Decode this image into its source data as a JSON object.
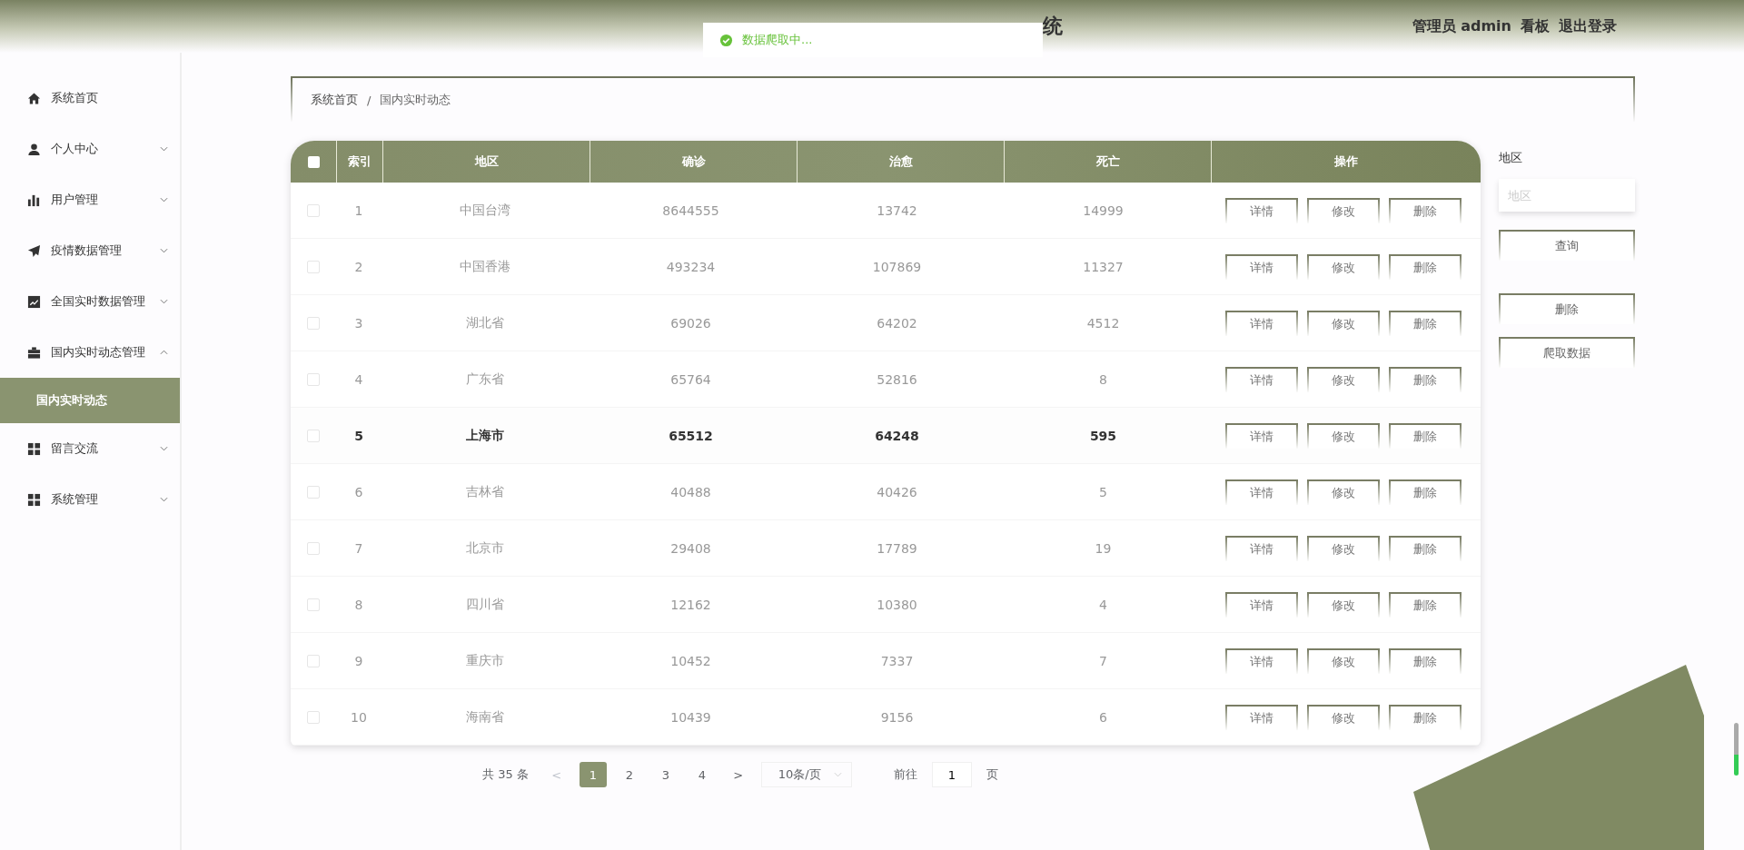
{
  "header": {
    "title_visible": "统",
    "user": "管理员 admin",
    "links": [
      "看板",
      "退出登录"
    ]
  },
  "toast": {
    "kind": "success",
    "message": "数据爬取中..."
  },
  "sidebar": {
    "items": [
      {
        "label": "系统首页",
        "expandable": false
      },
      {
        "label": "个人中心",
        "expandable": true,
        "expanded": false
      },
      {
        "label": "用户管理",
        "expandable": true,
        "expanded": false
      },
      {
        "label": "疫情数据管理",
        "expandable": true,
        "expanded": false
      },
      {
        "label": "全国实时数据管理",
        "expandable": true,
        "expanded": false
      },
      {
        "label": "国内实时动态管理",
        "expandable": true,
        "expanded": true,
        "children": [
          {
            "label": "国内实时动态",
            "selected": true
          }
        ]
      },
      {
        "label": "留言交流",
        "expandable": true,
        "expanded": false
      },
      {
        "label": "系统管理",
        "expandable": true,
        "expanded": false
      }
    ]
  },
  "breadcrumb": {
    "items": [
      "系统首页",
      "国内实时动态"
    ],
    "separator": "/"
  },
  "table": {
    "columns": [
      "索引",
      "地区",
      "确诊",
      "治愈",
      "死亡",
      "操作"
    ],
    "select_all_checked": false,
    "rows": [
      {
        "index": "1",
        "region": "中国台湾",
        "confirmed": "8644555",
        "cured": "13742",
        "deaths": "14999",
        "highlighted": false,
        "checked": false,
        "actions": [
          "详情",
          "修改",
          "删除"
        ]
      },
      {
        "index": "2",
        "region": "中国香港",
        "confirmed": "493234",
        "cured": "107869",
        "deaths": "11327",
        "highlighted": false,
        "checked": false,
        "actions": [
          "详情",
          "修改",
          "删除"
        ]
      },
      {
        "index": "3",
        "region": "湖北省",
        "confirmed": "69026",
        "cured": "64202",
        "deaths": "4512",
        "highlighted": false,
        "checked": false,
        "actions": [
          "详情",
          "修改",
          "删除"
        ]
      },
      {
        "index": "4",
        "region": "广东省",
        "confirmed": "65764",
        "cured": "52816",
        "deaths": "8",
        "highlighted": false,
        "checked": false,
        "actions": [
          "详情",
          "修改",
          "删除"
        ]
      },
      {
        "index": "5",
        "region": "上海市",
        "confirmed": "65512",
        "cured": "64248",
        "deaths": "595",
        "highlighted": true,
        "checked": false,
        "actions": [
          "详情",
          "修改",
          "删除"
        ]
      },
      {
        "index": "6",
        "region": "吉林省",
        "confirmed": "40488",
        "cured": "40426",
        "deaths": "5",
        "highlighted": false,
        "checked": false,
        "actions": [
          "详情",
          "修改",
          "删除"
        ]
      },
      {
        "index": "7",
        "region": "北京市",
        "confirmed": "29408",
        "cured": "17789",
        "deaths": "19",
        "highlighted": false,
        "checked": false,
        "actions": [
          "详情",
          "修改",
          "删除"
        ]
      },
      {
        "index": "8",
        "region": "四川省",
        "confirmed": "12162",
        "cured": "10380",
        "deaths": "4",
        "highlighted": false,
        "checked": false,
        "actions": [
          "详情",
          "修改",
          "删除"
        ]
      },
      {
        "index": "9",
        "region": "重庆市",
        "confirmed": "10452",
        "cured": "7337",
        "deaths": "7",
        "highlighted": false,
        "checked": false,
        "actions": [
          "详情",
          "修改",
          "删除"
        ]
      },
      {
        "index": "10",
        "region": "海南省",
        "confirmed": "10439",
        "cured": "9156",
        "deaths": "6",
        "highlighted": false,
        "checked": false,
        "actions": [
          "详情",
          "修改",
          "删除"
        ]
      }
    ]
  },
  "search_panel": {
    "label": "地区",
    "placeholder": "地区",
    "buttons": [
      "查询",
      "删除",
      "爬取数据"
    ]
  },
  "pagination": {
    "total": "共 35 条",
    "prev": "<",
    "next": ">",
    "pages": [
      {
        "label": "1",
        "selected": true
      },
      {
        "label": "2",
        "selected": false
      },
      {
        "label": "3",
        "selected": false
      },
      {
        "label": "4",
        "selected": false
      }
    ],
    "page_size": "10条/页",
    "goto_label": "前往",
    "goto_value": "1",
    "goto_suffix": "页"
  }
}
